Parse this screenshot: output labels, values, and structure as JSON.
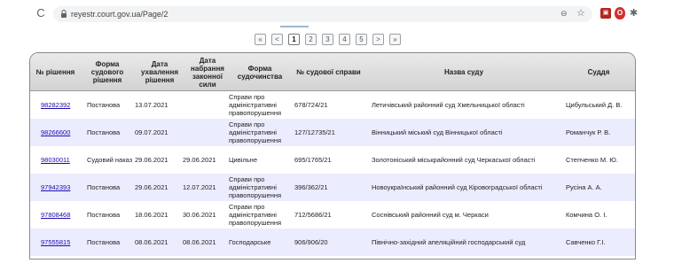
{
  "browser": {
    "url": "reyestr.court.gov.ua/Page/2",
    "reload_glyph": "C",
    "zoom_glyph": "⊖",
    "star_glyph": "☆",
    "extensions": [
      "shield-extension-icon",
      "opera-extension-icon",
      "puzzle-extensions-icon"
    ]
  },
  "pager": {
    "items": [
      "«",
      "<",
      "1",
      "2",
      "3",
      "4",
      "5",
      ">",
      "»"
    ],
    "active": "1"
  },
  "table": {
    "headers": [
      "№ рішення",
      "Форма судового рішення",
      "Дата ухвалення рішення",
      "Дата набрання законної сили",
      "Форма судочинства",
      "№ судової справи",
      "Назва суду",
      "Суддя"
    ],
    "rows": [
      [
        "98282392",
        "Постанова",
        "13.07.2021",
        "",
        "Справи про адміністративні правопорушення",
        "678/724/21",
        "Летичівський районний суд Хмельницької області",
        "Цибульський Д. В."
      ],
      [
        "98266600",
        "Постанова",
        "09.07.2021",
        "",
        "Справи про адміністративні правопорушення",
        "127/12735/21",
        "Вінницький міський суд Вінницької області",
        "Романчук Р. В."
      ],
      [
        "98030011",
        "Судовий наказ",
        "29.06.2021",
        "29.06.2021",
        "Цивільне",
        "695/1765/21",
        "Золотоніський міськрайонний суд Черкаської області",
        "Степченко М. Ю."
      ],
      [
        "97942393",
        "Постанова",
        "29.06.2021",
        "12.07.2021",
        "Справи про адміністративні правопорушення",
        "396/362/21",
        "Новоукраїнський районний суд Кіровоградської області",
        "Русіна А. А."
      ],
      [
        "97808468",
        "Постанова",
        "18.06.2021",
        "30.06.2021",
        "Справи про адміністративні правопорушення",
        "712/5686/21",
        "Соснівський районний суд м. Черкаси",
        "Комчина О. І."
      ],
      [
        "97555815",
        "Постанова",
        "08.06.2021",
        "08.06.2021",
        "Господарське",
        "906/906/20",
        "Північно-західний апеляційний господарський суд",
        "Савченко Г.І."
      ]
    ]
  }
}
